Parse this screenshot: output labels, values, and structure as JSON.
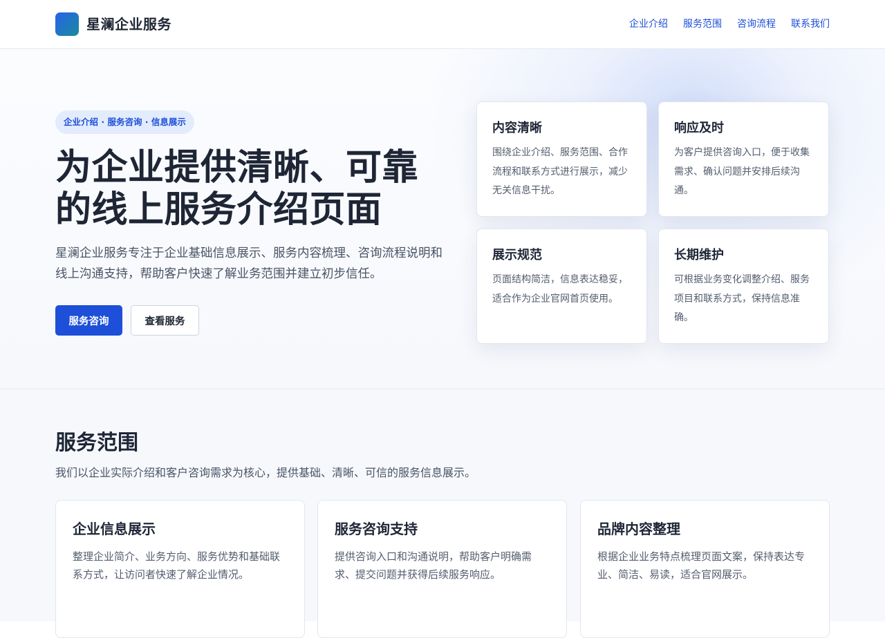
{
  "header": {
    "brand": "星澜企业服务",
    "nav": [
      {
        "label": "企业介绍"
      },
      {
        "label": "服务范围"
      },
      {
        "label": "咨询流程"
      },
      {
        "label": "联系我们"
      }
    ]
  },
  "hero": {
    "badge": "企业介绍 · 服务咨询 · 信息展示",
    "title_line1": "为企业提供清晰、可靠",
    "title_line2": "的线上服务介绍页面",
    "description": "星澜企业服务专注于企业基础信息展示、服务内容梳理、咨询流程说明和线上沟通支持，帮助客户快速了解业务范围并建立初步信任。",
    "primary_button": "服务咨询",
    "secondary_button": "查看服务",
    "features": [
      {
        "title": "内容清晰",
        "text": "围绕企业介绍、服务范围、合作流程和联系方式进行展示，减少无关信息干扰。"
      },
      {
        "title": "响应及时",
        "text": "为客户提供咨询入口，便于收集需求、确认问题并安排后续沟通。"
      },
      {
        "title": "展示规范",
        "text": "页面结构简洁，信息表达稳妥，适合作为企业官网首页使用。"
      },
      {
        "title": "长期维护",
        "text": "可根据业务变化调整介绍、服务项目和联系方式，保持信息准确。"
      }
    ]
  },
  "services": {
    "title": "服务范围",
    "subtitle": "我们以企业实际介绍和客户咨询需求为核心，提供基础、清晰、可信的服务信息展示。",
    "cards": [
      {
        "title": "企业信息展示",
        "text": "整理企业简介、业务方向、服务优势和基础联系方式，让访问者快速了解企业情况。"
      },
      {
        "title": "服务咨询支持",
        "text": "提供咨询入口和沟通说明，帮助客户明确需求、提交问题并获得后续服务响应。"
      },
      {
        "title": "品牌内容整理",
        "text": "根据企业业务特点梳理页面文案，保持表达专业、简洁、易读，适合官网展示。"
      }
    ]
  },
  "colors": {
    "accent": "#1d4fd8",
    "heading": "#1e2636",
    "body_text": "#4a5466"
  }
}
